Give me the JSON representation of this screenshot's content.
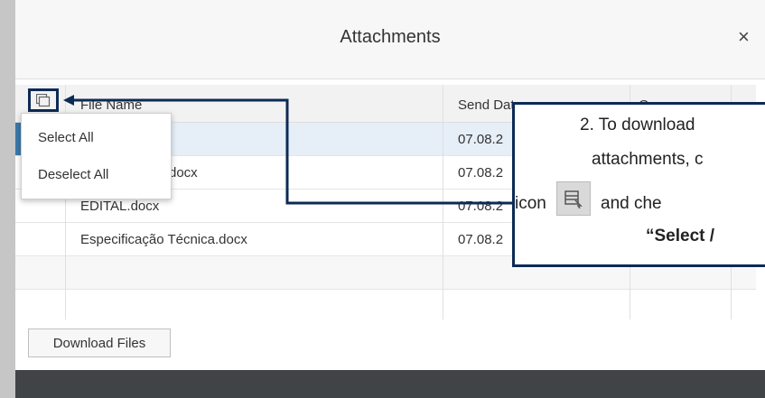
{
  "dialog": {
    "title": "Attachments",
    "close_glyph": "×"
  },
  "table": {
    "columns": [
      "File Name",
      "Send Date",
      "Owner"
    ],
    "rows": [
      {
        "file_name": "",
        "send_date": "07.08.2",
        "owner": "",
        "selected": true
      },
      {
        "file_name": "docx",
        "send_date": "07.08.2",
        "owner": ""
      },
      {
        "file_name": "EDITAL.docx",
        "send_date": "07.08.2",
        "owner": ""
      },
      {
        "file_name": "Especificação Técnica.docx",
        "send_date": "07.08.2",
        "owner": ""
      },
      {
        "file_name": "",
        "send_date": "",
        "owner": ""
      }
    ]
  },
  "select_menu": {
    "items": [
      "Select All",
      "Deselect All"
    ]
  },
  "download_button": "Download Files",
  "callout": {
    "line1": "2. To download",
    "line2": "attachments, c",
    "line3a": "icon",
    "line3b": "and che",
    "line4": "“Select /"
  },
  "icons": {
    "column_select": "multi-select-icon",
    "close": "close-icon",
    "callout_icon": "list-select-icon"
  },
  "colors": {
    "callout_border": "#0d2a55",
    "selected_row": "#e6eef7",
    "selection_marker": "#3b78a8",
    "footer": "#404447"
  }
}
